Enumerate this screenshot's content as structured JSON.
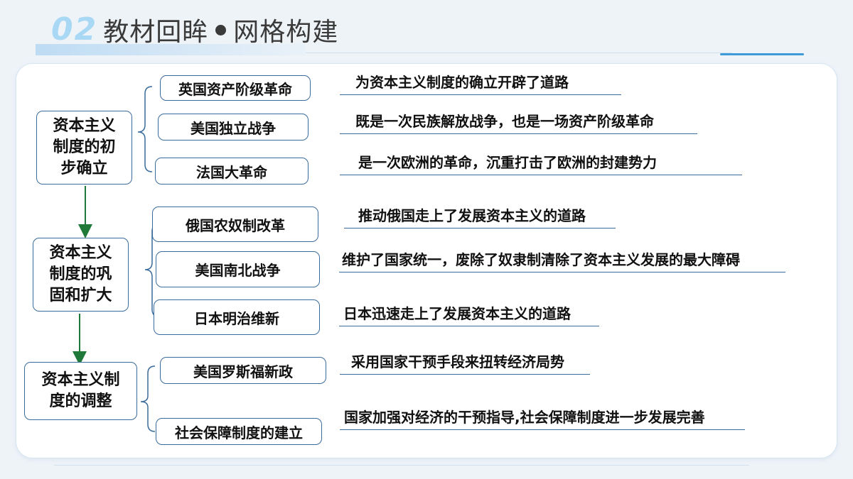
{
  "header": {
    "number": "02",
    "title_left": "教材回眸",
    "title_right": "网格构建"
  },
  "diagram": {
    "groups": [
      {
        "label": "资本主义\n制度的初\n步确立",
        "items": [
          {
            "event": "英国资产阶级革命",
            "desc": "为资本主义制度的确立开辟了道路"
          },
          {
            "event": "美国独立战争",
            "desc": "既是一次民族解放战争，也是一场资产阶级革命"
          },
          {
            "event": "法国大革命",
            "desc": "是一次欧洲的革命，沉重打击了欧洲的封建势力"
          }
        ]
      },
      {
        "label": "资本主义\n制度的巩\n固和扩大",
        "items": [
          {
            "event": "俄国农奴制改革",
            "desc": "推动俄国走上了发展资本主义的道路"
          },
          {
            "event": "美国南北战争",
            "desc": "维护了国家统一，废除了奴隶制清除了资本主义发展的最大障碍"
          },
          {
            "event": "日本明治维新",
            "desc": "日本迅速走上了发展资本主义的道路"
          }
        ]
      },
      {
        "label": "资本主义制\n度的调整",
        "items": [
          {
            "event": "美国罗斯福新政",
            "desc": "采用国家干预手段来扭转经济局势"
          },
          {
            "event": "社会保障制度的建立",
            "desc": "国家加强对经济的干预指导,社会保障制度进一步发展完善"
          }
        ]
      }
    ]
  },
  "colors": {
    "border": "#3a6c9b",
    "arrow": "#1f7a3a",
    "accent": "#3f9ad8"
  }
}
